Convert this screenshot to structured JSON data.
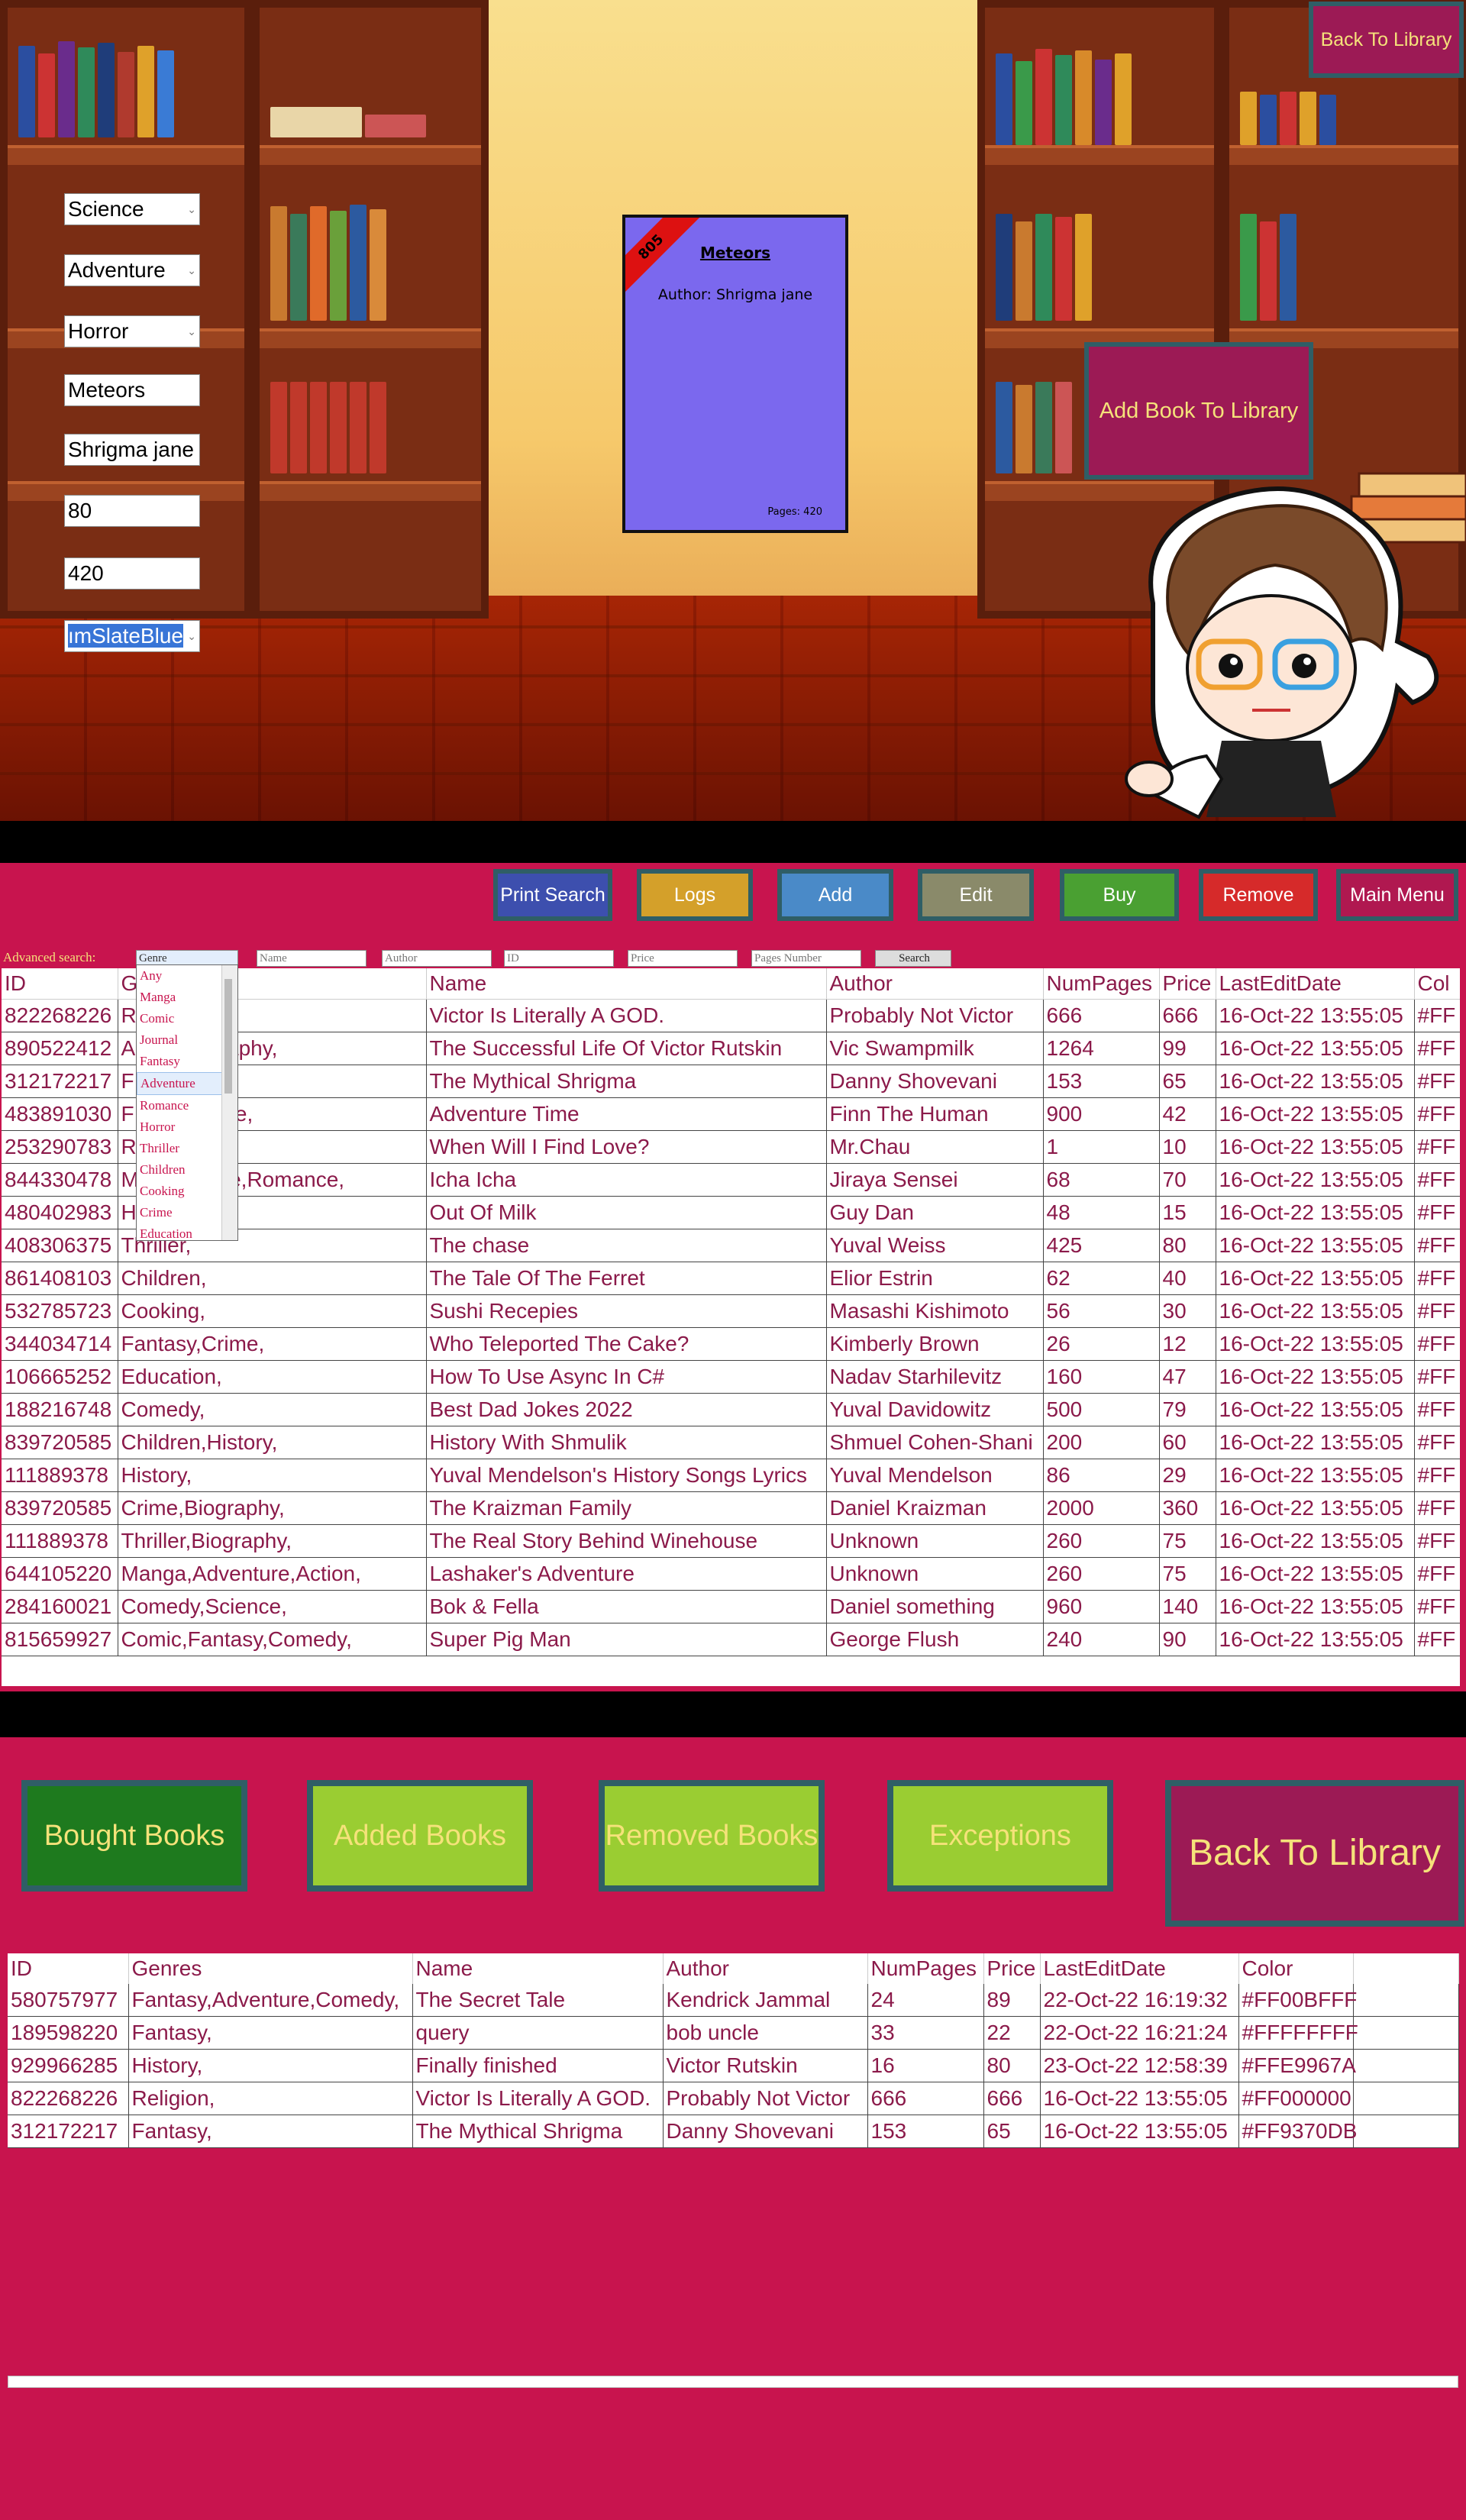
{
  "panel1": {
    "form": {
      "genre1": "Science",
      "genre2": "Adventure",
      "genre3": "Horror",
      "name": "Meteors",
      "author": "Shrigma jane",
      "price": "80",
      "pages": "420",
      "color": "ımSlateBlue"
    },
    "book_card": {
      "ribbon": "805",
      "title": "Meteors",
      "author": "Author: Shrigma jane",
      "pages": "Pages: 420",
      "color": "#7B68EE"
    },
    "back_button": "Back To Library",
    "add_button": "Add Book To Library"
  },
  "panel2": {
    "buttons": {
      "print_search": "Print Search",
      "logs": "Logs",
      "add": "Add",
      "edit": "Edit",
      "buy": "Buy",
      "remove": "Remove",
      "main_menu": "Main Menu"
    },
    "advanced_search": {
      "label": "Advanced search:",
      "genre": "Genre",
      "name": "Name",
      "author": "Author",
      "id": "ID",
      "price": "Price",
      "pages": "Pages Number",
      "search": "Search"
    },
    "dropdown": [
      "Any",
      "Manga",
      "Comic",
      "Journal",
      "Fantasy",
      "Adventure",
      "Romance",
      "Horror",
      "Thriller",
      "Children",
      "Cooking",
      "Crime",
      "Education"
    ],
    "columns": [
      "ID",
      "G",
      "Name",
      "Author",
      "NumPages",
      "Price",
      "LastEditDate",
      "Col"
    ],
    "rows": [
      [
        "822268226",
        "R",
        "Victor Is Literally A GOD.",
        "Probably Not Victor",
        "666",
        "666",
        "16-Oct-22 13:55:05",
        "#FF"
      ],
      [
        "890522412",
        "A",
        "Biography,",
        "The Successful Life Of Victor Rutskin",
        "Vic Swampmilk",
        "1264",
        "99",
        "16-Oct-22 13:55:05",
        "#FF"
      ],
      [
        "312172217",
        "F",
        "",
        "The Mythical Shrigma",
        "Danny Shovevani",
        "153",
        "65",
        "16-Oct-22 13:55:05",
        "#FF"
      ],
      [
        "483891030",
        "F",
        "venture,",
        "Adventure Time",
        "Finn The Human",
        "900",
        "42",
        "16-Oct-22 13:55:05",
        "#FF"
      ],
      [
        "253290783",
        "R",
        "",
        "When Will I Find Love?",
        "Mr.Chau",
        "1",
        "10",
        "16-Oct-22 13:55:05",
        "#FF"
      ],
      [
        "844330478",
        "M",
        "enture,Romance,",
        "Icha Icha",
        "Jiraya Sensei",
        "68",
        "70",
        "16-Oct-22 13:55:05",
        "#FF"
      ],
      [
        "480402983",
        "H",
        "",
        "Out Of Milk",
        "Guy Dan",
        "48",
        "15",
        "16-Oct-22 13:55:05",
        "#FF"
      ],
      [
        "408306375",
        "Thriller,",
        "",
        "The chase",
        "Yuval Weiss",
        "425",
        "80",
        "16-Oct-22 13:55:05",
        "#FF"
      ],
      [
        "861408103",
        "Children,",
        "",
        "The Tale Of The Ferret",
        "Elior Estrin",
        "62",
        "40",
        "16-Oct-22 13:55:05",
        "#FF"
      ],
      [
        "532785723",
        "Cooking,",
        "",
        "Sushi Recepies",
        "Masashi Kishimoto",
        "56",
        "30",
        "16-Oct-22 13:55:05",
        "#FF"
      ],
      [
        "344034714",
        "Fantasy,Crime,",
        "",
        "Who Teleported The Cake?",
        "Kimberly Brown",
        "26",
        "12",
        "16-Oct-22 13:55:05",
        "#FF"
      ],
      [
        "106665252",
        "Education,",
        "",
        "How To Use Async In C#",
        "Nadav Starhilevitz",
        "160",
        "47",
        "16-Oct-22 13:55:05",
        "#FF"
      ],
      [
        "188216748",
        "Comedy,",
        "",
        "Best Dad Jokes 2022",
        "Yuval Davidowitz",
        "500",
        "79",
        "16-Oct-22 13:55:05",
        "#FF"
      ],
      [
        "839720585",
        "Children,History,",
        "",
        "History With Shmulik",
        "Shmuel Cohen-Shani",
        "200",
        "60",
        "16-Oct-22 13:55:05",
        "#FF"
      ],
      [
        "111889378",
        "History,",
        "",
        "Yuval Mendelson's History Songs Lyrics",
        "Yuval Mendelson",
        "86",
        "29",
        "16-Oct-22 13:55:05",
        "#FF"
      ],
      [
        "839720585",
        "Crime,Biography,",
        "",
        "The Kraizman Family",
        "Daniel Kraizman",
        "2000",
        "360",
        "16-Oct-22 13:55:05",
        "#FF"
      ],
      [
        "111889378",
        "Thriller,Biography,",
        "",
        "The Real Story Behind Winehouse",
        "Unknown",
        "260",
        "75",
        "16-Oct-22 13:55:05",
        "#FF"
      ],
      [
        "644105220",
        "Manga,Adventure,Action,",
        "",
        "Lashaker's Adventure",
        "Unknown",
        "260",
        "75",
        "16-Oct-22 13:55:05",
        "#FF"
      ],
      [
        "284160021",
        "Comedy,Science,",
        "",
        "Bok & Fella",
        "Daniel something",
        "960",
        "140",
        "16-Oct-22 13:55:05",
        "#FF"
      ],
      [
        "815659927",
        "Comic,Fantasy,Comedy,",
        "",
        "Super Pig Man",
        "George Flush",
        "240",
        "90",
        "16-Oct-22 13:55:05",
        "#FF"
      ]
    ]
  },
  "panel3": {
    "buttons": {
      "bought": "Bought Books",
      "added": "Added Books",
      "removed": "Removed Books",
      "exceptions": "Exceptions",
      "back": "Back To Library"
    },
    "columns": [
      "ID",
      "Genres",
      "Name",
      "Author",
      "NumPages",
      "Price",
      "LastEditDate",
      "Color"
    ],
    "rows": [
      [
        "580757977",
        "Fantasy,Adventure,Comedy,",
        "The Secret Tale",
        "Kendrick Jammal",
        "24",
        "89",
        "22-Oct-22 16:19:32",
        "#FF00BFFF"
      ],
      [
        "189598220",
        "Fantasy,",
        "query",
        "bob uncle",
        "33",
        "22",
        "22-Oct-22 16:21:24",
        "#FFFFFFFF"
      ],
      [
        "929966285",
        "History,",
        "Finally finished",
        "Victor Rutskin",
        "16",
        "80",
        "23-Oct-22 12:58:39",
        "#FFE9967A"
      ],
      [
        "822268226",
        "Religion,",
        "Victor Is Literally A GOD.",
        "Probably Not Victor",
        "666",
        "666",
        "16-Oct-22 13:55:05",
        "#FF000000"
      ],
      [
        "312172217",
        "Fantasy,",
        "The Mythical Shrigma",
        "Danny Shovevani",
        "153",
        "65",
        "16-Oct-22 13:55:05",
        "#FF9370DB"
      ]
    ]
  },
  "colors": {
    "panel_bg": "#C8144E",
    "button_border": "#2F5E66",
    "accent_text": "#F5E27A"
  }
}
